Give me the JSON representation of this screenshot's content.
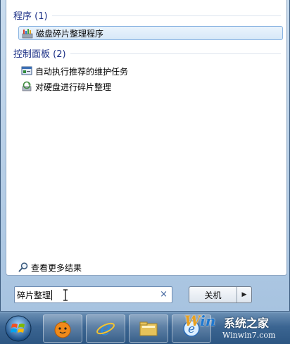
{
  "groups": {
    "programs": {
      "header": "程序 (1)",
      "items": [
        {
          "label": "磁盘碎片整理程序",
          "icon": "disk-defragmenter-icon"
        }
      ]
    },
    "control_panel": {
      "header": "控制面板 (2)",
      "items": [
        {
          "label": "自动执行推荐的维护任务",
          "icon": "maintenance-task-icon"
        },
        {
          "label": "对硬盘进行碎片整理",
          "icon": "defragment-disk-icon"
        }
      ]
    }
  },
  "see_more": {
    "label": "查看更多结果",
    "icon": "magnifier-icon"
  },
  "search": {
    "value": "碎片整理",
    "clear_glyph": "×"
  },
  "shutdown": {
    "label": "关机",
    "arrow": "▶"
  },
  "taskbar": {
    "items": [
      "start-orb",
      "media-center",
      "internet-explorer",
      "windows-explorer",
      "ie-pinned"
    ]
  },
  "watermark": {
    "brand_w": "W",
    "brand_in": "in",
    "title": "系统之家",
    "url": "Winwin7.com"
  },
  "colors": {
    "group_header": "#1e3287",
    "selection_border": "#8ab4e2",
    "taskbar": "#3b6592"
  }
}
